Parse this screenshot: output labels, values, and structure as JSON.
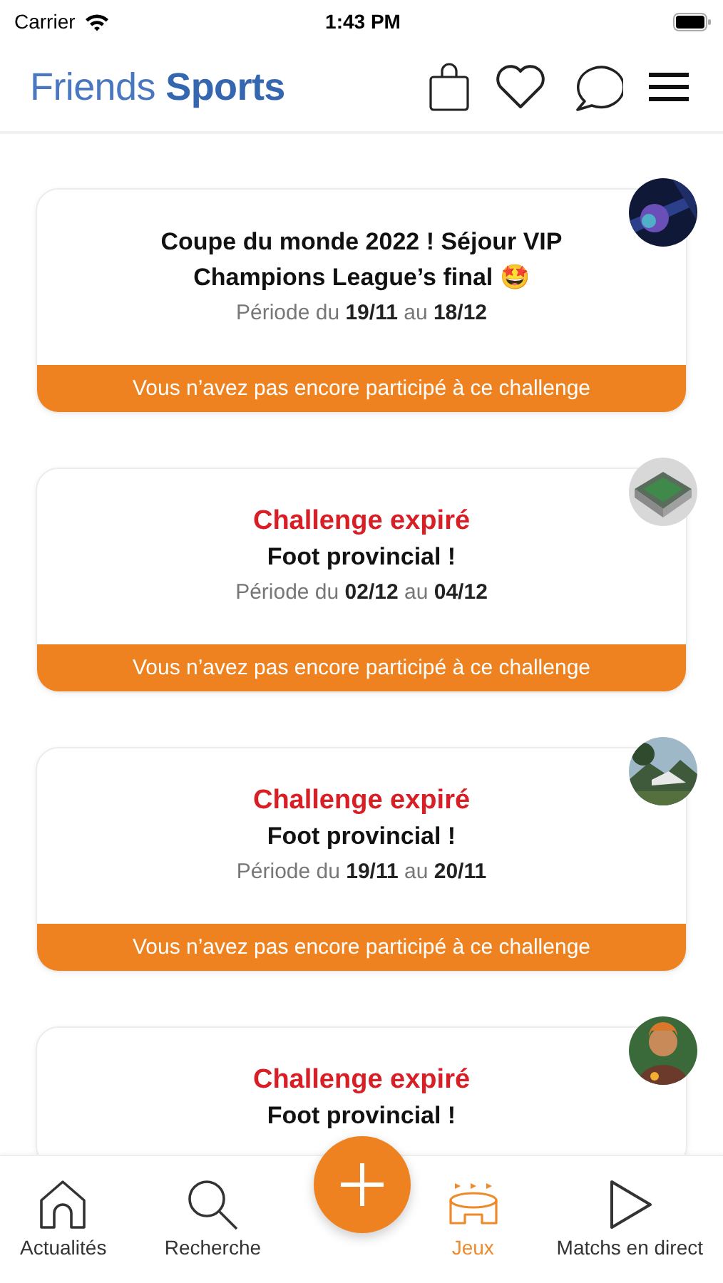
{
  "status_bar": {
    "carrier": "Carrier",
    "time": "1:43 PM"
  },
  "header": {
    "logo": "Friends **Sports**"
  },
  "challenges": [
    {
      "title": "Coupe du monde 2022 ! Séjour VIP Champions League’s final 🤩",
      "period": "Période du **19/11** au **18/12**",
      "banner": "Vous n’avez pas encore participé à ce challenge"
    },
    {
      "status": "Challenge expiré",
      "title": "Foot provincial !",
      "period": "Période du **02/12** au **04/12**",
      "banner": "Vous n’avez pas encore participé à ce challenge"
    },
    {
      "status": "Challenge expiré",
      "title": "Foot provincial !",
      "period": "Période du **19/11** au **20/11**",
      "banner": "Vous n’avez pas encore participé à ce challenge"
    },
    {
      "status": "Challenge expiré",
      "title": "Foot provincial !"
    }
  ],
  "tabs": [
    {
      "label": "Actualités",
      "selected": false
    },
    {
      "label": "Recherche",
      "selected": false
    },
    {
      "label": "Jeux",
      "selected": true
    },
    {
      "label": "Matchs en direct",
      "selected": false
    }
  ]
}
